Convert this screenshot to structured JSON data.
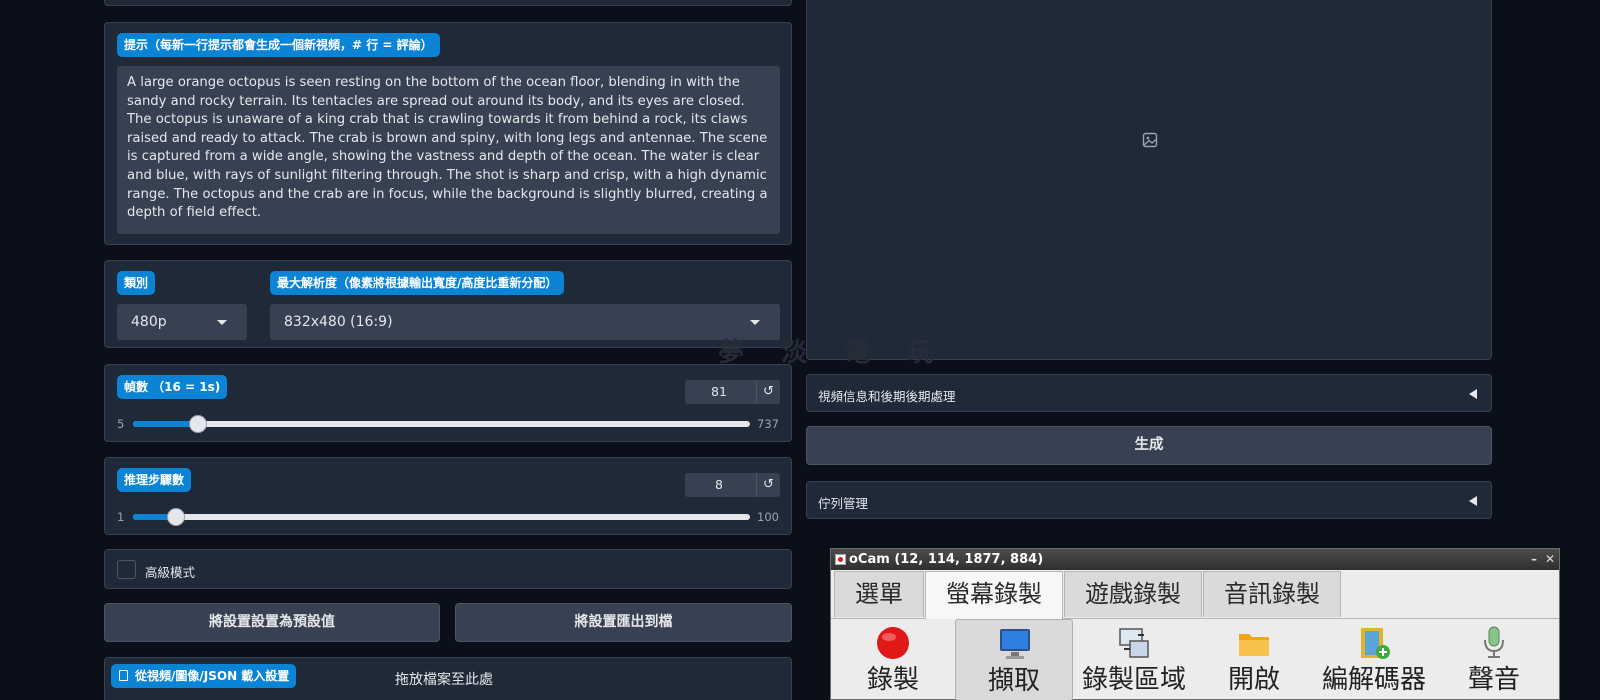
{
  "prompt": {
    "label": "提示（每新一行提示都會生成一個新視頻，# 行 = 評論）",
    "text": "A large orange octopus is seen resting on the bottom of the ocean floor, blending in with the sandy and rocky terrain. Its tentacles are spread out around its body, and its eyes are closed. The octopus is unaware of a king crab that is crawling towards it from behind a rock, its claws raised and ready to attack. The crab is brown and spiny, with long legs and antennae. The scene is captured from a wide angle, showing the vastness and depth of the ocean. The water is clear and blue, with rays of sunlight filtering through. The shot is sharp and crisp, with a high dynamic range. The octopus and the crab are in focus, while the background is slightly blurred, creating a depth of field effect."
  },
  "category": {
    "label": "類別",
    "value": "480p"
  },
  "resolution": {
    "label": "最大解析度（像素將根據輸出寬度/高度比重新分配）",
    "value": "832x480 (16:9)"
  },
  "frames": {
    "label": "幀數 （16 = 1s)",
    "value": "81",
    "min": "5",
    "max": "737",
    "fraction": 0.105
  },
  "steps": {
    "label": "推理步驟數",
    "value": "8",
    "min": "1",
    "max": "100",
    "fraction": 0.07
  },
  "advanced": {
    "label": "高級模式",
    "checked": false
  },
  "buttons": {
    "set_default": "將設置設置為預設值",
    "export": "將設置匯出到檔"
  },
  "load": {
    "label": "從視頻/圖像/JSON 載入設置",
    "drop_text": "拖放檔案至此處"
  },
  "right": {
    "video_info": "視頻信息和後期後期處理",
    "generate": "生成",
    "queue": "佇列管理"
  },
  "icons": {
    "reset": "↺",
    "image_placeholder": "image-icon",
    "file": "file-icon"
  },
  "watermark": "夢 淡 電 玩",
  "ocam": {
    "title": "oCam (12, 114, 1877, 884)",
    "tabs": [
      "選單",
      "螢幕錄製",
      "遊戲錄製",
      "音訊錄製"
    ],
    "tools": [
      "錄製",
      "擷取",
      "錄製區域",
      "開啟",
      "編解碼器",
      "聲音"
    ]
  },
  "colors": {
    "background": "#0b0f19",
    "panel": "#1f2937",
    "accent": "#0b84d6",
    "input": "#374151"
  }
}
